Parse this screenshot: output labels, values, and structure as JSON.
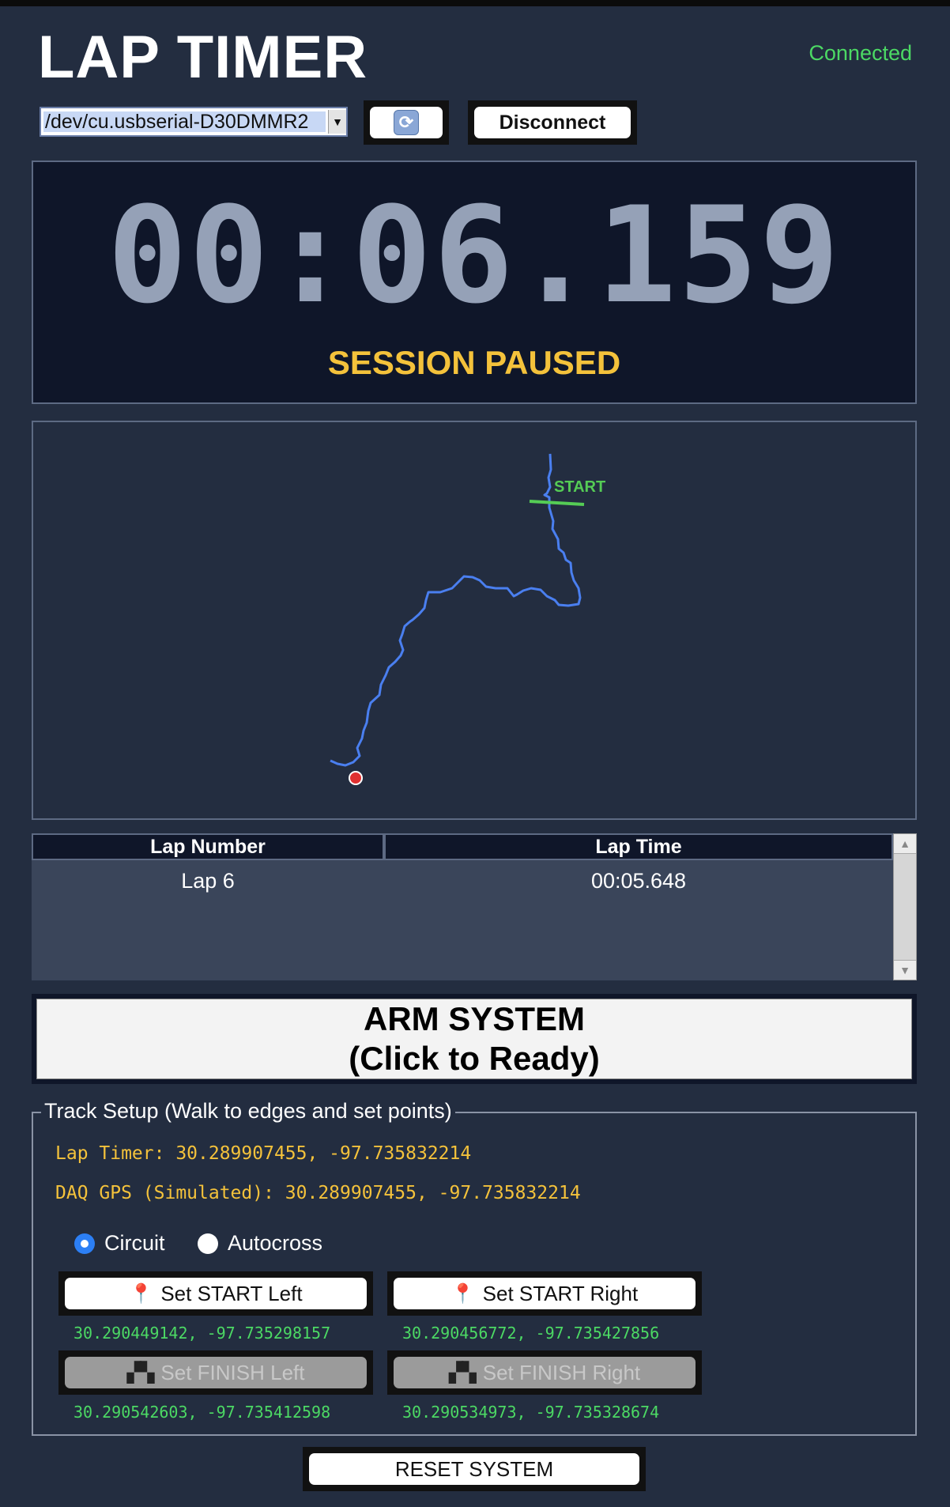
{
  "app": {
    "title": "LAP TIMER",
    "connection_status": "Connected"
  },
  "connection": {
    "port_value": "/dev/cu.usbserial-D30DMMR2",
    "refresh_icon": "refresh-icon",
    "disconnect_label": "Disconnect"
  },
  "timer": {
    "display": "00:06.159",
    "status": "SESSION PAUSED"
  },
  "map": {
    "start_label": "START"
  },
  "laps": {
    "columns": [
      "Lap Number",
      "Lap Time"
    ],
    "rows": [
      {
        "number": "Lap 6",
        "time": "00:05.648"
      }
    ]
  },
  "arm": {
    "line1": "ARM SYSTEM",
    "line2": "(Click to Ready)"
  },
  "track_setup": {
    "legend": "Track Setup (Walk to edges and set points)",
    "lap_timer_coord": "Lap Timer: 30.289907455, -97.735832214",
    "daq_coord": "DAQ GPS (Simulated): 30.289907455, -97.735832214",
    "modes": [
      {
        "label": "Circuit",
        "selected": true
      },
      {
        "label": "Autocross",
        "selected": false
      }
    ],
    "set_start_left": {
      "label": "Set START Left",
      "coord": "30.290449142, -97.735298157",
      "icon": "pin-icon"
    },
    "set_start_right": {
      "label": "Set START Right",
      "coord": "30.290456772, -97.735427856",
      "icon": "pin-icon"
    },
    "set_finish_left": {
      "label": "Set FINISH Left",
      "coord": "30.290542603, -97.735412598",
      "icon": "checkered-flag-icon"
    },
    "set_finish_right": {
      "label": "Set FINISH Right",
      "coord": "30.290534973, -97.735328674",
      "icon": "checkered-flag-icon"
    }
  },
  "reset": {
    "label": "RESET SYSTEM"
  },
  "colors": {
    "background": "#232d40",
    "panel": "#0f1629",
    "timer_digits": "#95a1b7",
    "status_yellow": "#f4c23b",
    "connected_green": "#4cd964",
    "track_blue": "#4a7ff0",
    "start_line_green": "#55cc55"
  }
}
